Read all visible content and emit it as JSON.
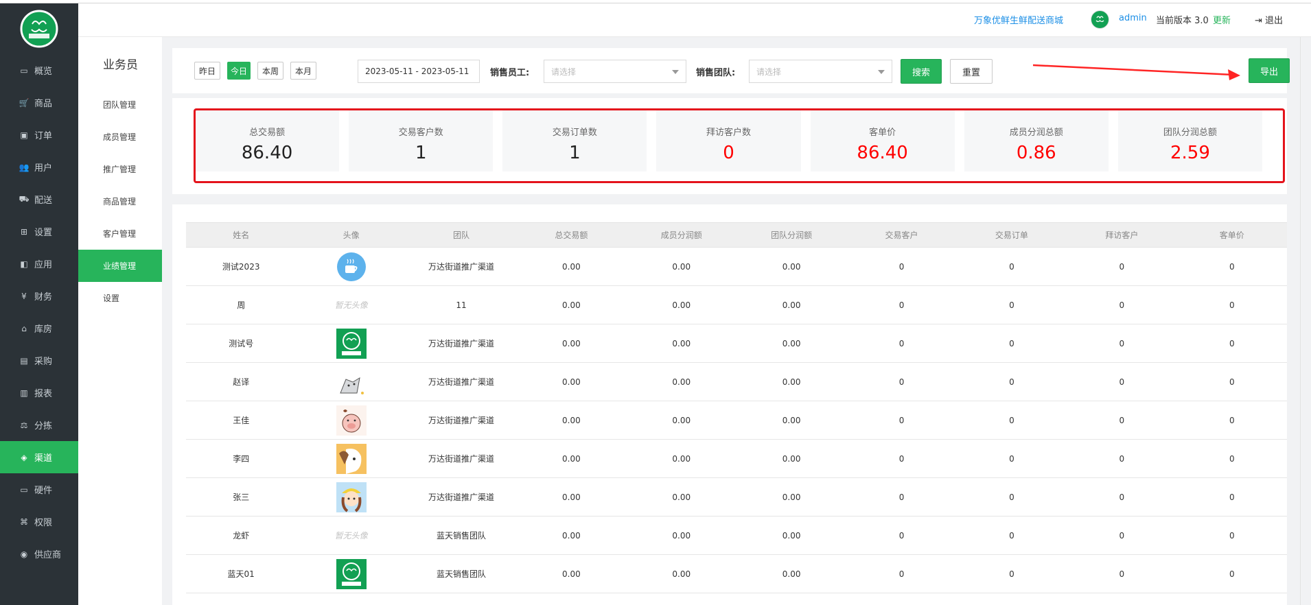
{
  "sidebar": {
    "logo_icon": "brand-logo-icon",
    "items": [
      {
        "label": "概览",
        "icon": "monitor-icon"
      },
      {
        "label": "商品",
        "icon": "cart-icon"
      },
      {
        "label": "订单",
        "icon": "order-icon"
      },
      {
        "label": "用户",
        "icon": "users-icon"
      },
      {
        "label": "配送",
        "icon": "truck-icon"
      },
      {
        "label": "设置",
        "icon": "sitemap-icon"
      },
      {
        "label": "应用",
        "icon": "app-icon"
      },
      {
        "label": "财务",
        "icon": "yen-icon"
      },
      {
        "label": "库房",
        "icon": "home-icon"
      },
      {
        "label": "采购",
        "icon": "bus-icon"
      },
      {
        "label": "报表",
        "icon": "bar-chart-icon"
      },
      {
        "label": "分拣",
        "icon": "scale-icon"
      },
      {
        "label": "渠道",
        "icon": "cube-icon"
      },
      {
        "label": "硬件",
        "icon": "desktop-icon"
      },
      {
        "label": "权限",
        "icon": "bank-icon"
      },
      {
        "label": "供应商",
        "icon": "group-icon"
      }
    ],
    "active_index": 12
  },
  "subnav": {
    "title": "业务员",
    "items": [
      "团队管理",
      "成员管理",
      "推广管理",
      "商品管理",
      "客户管理",
      "业绩管理",
      "设置"
    ],
    "active_index": 5
  },
  "header": {
    "shop_link": "万象优鲜生鲜配送商城",
    "user": "admin",
    "version": "当前版本 3.0",
    "update": "更新",
    "logout": "退出"
  },
  "filter": {
    "quick": [
      "昨日",
      "今日",
      "本周",
      "本月"
    ],
    "quick_active": 1,
    "date_range": "2023-05-11 - 2023-05-11",
    "staff_label": "销售员工:",
    "staff_placeholder": "请选择",
    "team_label": "销售团队:",
    "team_placeholder": "请选择",
    "search": "搜索",
    "reset": "重置",
    "export": "导出"
  },
  "stats": [
    {
      "label": "总交易额",
      "value": "86.40",
      "color": "#222222"
    },
    {
      "label": "交易客户数",
      "value": "1",
      "color": "#222222"
    },
    {
      "label": "交易订单数",
      "value": "1",
      "color": "#222222"
    },
    {
      "label": "拜访客户数",
      "value": "0",
      "color": "#ff0000"
    },
    {
      "label": "客单价",
      "value": "86.40",
      "color": "#ff0000"
    },
    {
      "label": "成员分润总额",
      "value": "0.86",
      "color": "#ff0000"
    },
    {
      "label": "团队分润总额",
      "value": "2.59",
      "color": "#ff0000"
    }
  ],
  "table": {
    "headers": [
      "姓名",
      "头像",
      "团队",
      "总交易额",
      "成员分润额",
      "团队分润额",
      "交易客户",
      "交易订单",
      "拜访客户",
      "客单价"
    ],
    "no_avatar_text": "暂无头像",
    "rows": [
      {
        "name": "测试2023",
        "avatar": "coffee-avatar",
        "team": "万达街道推广渠道",
        "total": "0.00",
        "member": "0.00",
        "team_share": "0.00",
        "customers": "0",
        "orders": "0",
        "visits": "0",
        "avg": "0"
      },
      {
        "name": "周",
        "avatar": "none",
        "team": "11",
        "total": "0.00",
        "member": "0.00",
        "team_share": "0.00",
        "customers": "0",
        "orders": "0",
        "visits": "0",
        "avg": "0"
      },
      {
        "name": "测试号",
        "avatar": "brand-avatar",
        "team": "万达街道推广渠道",
        "total": "0.00",
        "member": "0.00",
        "team_share": "0.00",
        "customers": "0",
        "orders": "0",
        "visits": "0",
        "avg": "0"
      },
      {
        "name": "赵译",
        "avatar": "cat-avatar",
        "team": "万达街道推广渠道",
        "total": "0.00",
        "member": "0.00",
        "team_share": "0.00",
        "customers": "0",
        "orders": "0",
        "visits": "0",
        "avg": "0"
      },
      {
        "name": "王佳",
        "avatar": "pig-avatar",
        "team": "万达街道推广渠道",
        "total": "0.00",
        "member": "0.00",
        "team_share": "0.00",
        "customers": "0",
        "orders": "0",
        "visits": "0",
        "avg": "0"
      },
      {
        "name": "李四",
        "avatar": "dog-avatar",
        "team": "万达街道推广渠道",
        "total": "0.00",
        "member": "0.00",
        "team_share": "0.00",
        "customers": "0",
        "orders": "0",
        "visits": "0",
        "avg": "0"
      },
      {
        "name": "张三",
        "avatar": "girl-avatar",
        "team": "万达街道推广渠道",
        "total": "0.00",
        "member": "0.00",
        "team_share": "0.00",
        "customers": "0",
        "orders": "0",
        "visits": "0",
        "avg": "0"
      },
      {
        "name": "龙虾",
        "avatar": "none",
        "team": "蓝天销售团队",
        "total": "0.00",
        "member": "0.00",
        "team_share": "0.00",
        "customers": "0",
        "orders": "0",
        "visits": "0",
        "avg": "0"
      },
      {
        "name": "蓝天01",
        "avatar": "brand-avatar",
        "team": "蓝天销售团队",
        "total": "0.00",
        "member": "0.00",
        "team_share": "0.00",
        "customers": "0",
        "orders": "0",
        "visits": "0",
        "avg": "0"
      }
    ]
  },
  "colors": {
    "accent": "#27b45b",
    "sidebar_bg": "#2b3237",
    "highlight_red": "#e4131b",
    "link_blue": "#1c8fe6"
  }
}
